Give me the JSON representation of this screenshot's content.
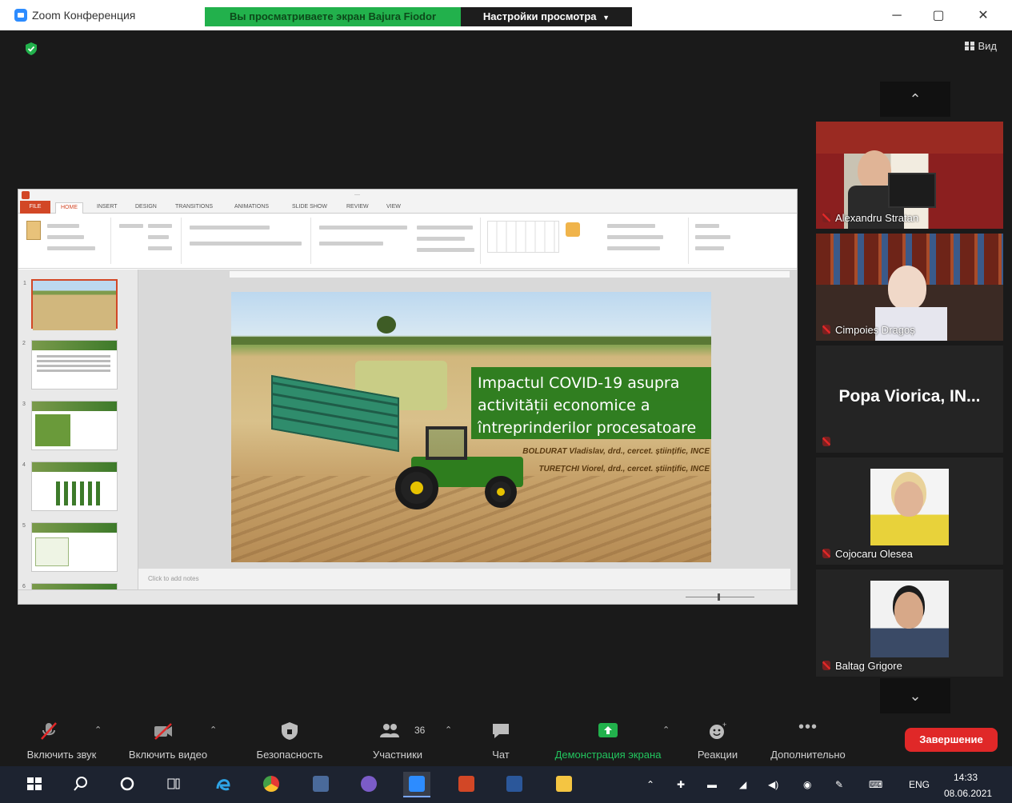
{
  "window": {
    "title": "Zoom Конференция",
    "share_banner": "Вы просматриваете экран Bajura Fiodor",
    "view_options": "Настройки просмотра",
    "view_options_icon": "chevron-down-icon",
    "minimize": "─",
    "restore": "▢",
    "close": "✕"
  },
  "meeting": {
    "view_label": "Вид",
    "encryption_icon": "shield-check-icon",
    "accent_green": "#22b14c"
  },
  "shared_screen": {
    "app": "PowerPoint",
    "ribbon_tabs": [
      "FILE",
      "HOME",
      "INSERT",
      "DESIGN",
      "TRANSITIONS",
      "ANIMATIONS",
      "SLIDE SHOW",
      "REVIEW",
      "VIEW"
    ],
    "active_tab": "HOME",
    "slide": {
      "title": "Impactul COVID-19 asupra activității economice a întreprinderilor procesatoare",
      "author_1": "BOLDURAT Vladislav, drd., cercet. științific, INCE",
      "author_2": "TUREȚCHI Viorel, drd., cercet. științific, INCE"
    },
    "notes_placeholder": "Click to add notes",
    "thumbnail_count": 6
  },
  "participants": [
    {
      "name": "Alexandru Stratan",
      "muted": true
    },
    {
      "name": "Cimpoieș Dragoș",
      "muted": true
    },
    {
      "name": "Popa Viorica, IN...",
      "muted": true,
      "video": false
    },
    {
      "name": "Cojocaru Olesea",
      "muted": true
    },
    {
      "name": "Baltag Grigore",
      "muted": true
    }
  ],
  "toolbar": {
    "unmute": "Включить звук",
    "start_video": "Включить видео",
    "security": "Безопасность",
    "participants": "Участники",
    "participants_count": "36",
    "chat": "Чат",
    "share_screen": "Демонстрация экрана",
    "reactions": "Реакции",
    "more": "Дополнительно",
    "end": "Завершение"
  },
  "taskbar": {
    "language": "ENG",
    "time": "14:33",
    "date": "08.06.2021"
  }
}
